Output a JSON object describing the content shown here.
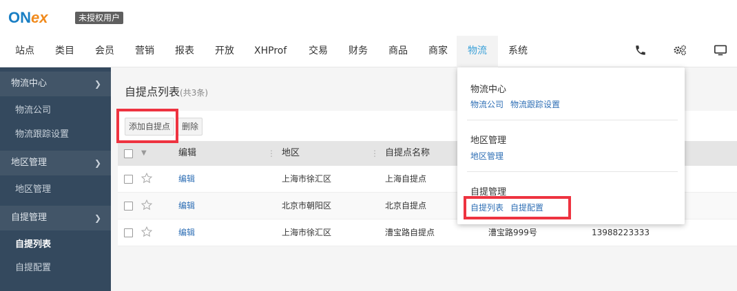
{
  "header": {
    "logo_on": "ON",
    "logo_ex": "ex",
    "unauth_badge": "未授权用户"
  },
  "nav": {
    "items": [
      "站点",
      "类目",
      "会员",
      "营销",
      "报表",
      "开放",
      "XHProf",
      "交易",
      "财务",
      "商品",
      "商家",
      "物流",
      "系统"
    ],
    "active": "物流",
    "icons": [
      "phone-icon",
      "gears-icon",
      "monitor-icon"
    ]
  },
  "sidebar": {
    "sections": [
      {
        "label": "物流中心",
        "items": [
          "物流公司",
          "物流跟踪设置"
        ]
      },
      {
        "label": "地区管理",
        "items": [
          "地区管理"
        ]
      },
      {
        "label": "自提管理",
        "items": [
          "自提列表",
          "自提配置"
        ]
      }
    ],
    "active_item": "自提列表"
  },
  "content": {
    "title": "自提点列表",
    "count": "(共3条)",
    "toolbar": {
      "add_label": "添加自提点",
      "delete_label": "删除"
    }
  },
  "table": {
    "columns": [
      "编辑",
      "地区",
      "自提点名称"
    ],
    "rows": [
      {
        "edit": "编辑",
        "region": "上海市徐汇区",
        "name": "上海自提点",
        "address": "",
        "phone": ""
      },
      {
        "edit": "编辑",
        "region": "北京市朝阳区",
        "name": "北京自提点",
        "address": "",
        "phone": ""
      },
      {
        "edit": "编辑",
        "region": "上海市徐汇区",
        "name": "漕宝路自提点",
        "address": "漕宝路999号",
        "phone": "13988223333"
      }
    ]
  },
  "dropdown": {
    "groups": [
      {
        "title": "物流中心",
        "links": [
          "物流公司",
          "物流跟踪设置"
        ]
      },
      {
        "title": "地区管理",
        "links": [
          "地区管理"
        ]
      },
      {
        "title": "自提管理",
        "links": [
          "自提列表",
          "自提配置"
        ]
      }
    ]
  },
  "colors": {
    "accent": "#3aa0d8",
    "sidebar_bg": "#34495e",
    "link": "#2f6fb5",
    "highlight_box": "#ee3340"
  }
}
